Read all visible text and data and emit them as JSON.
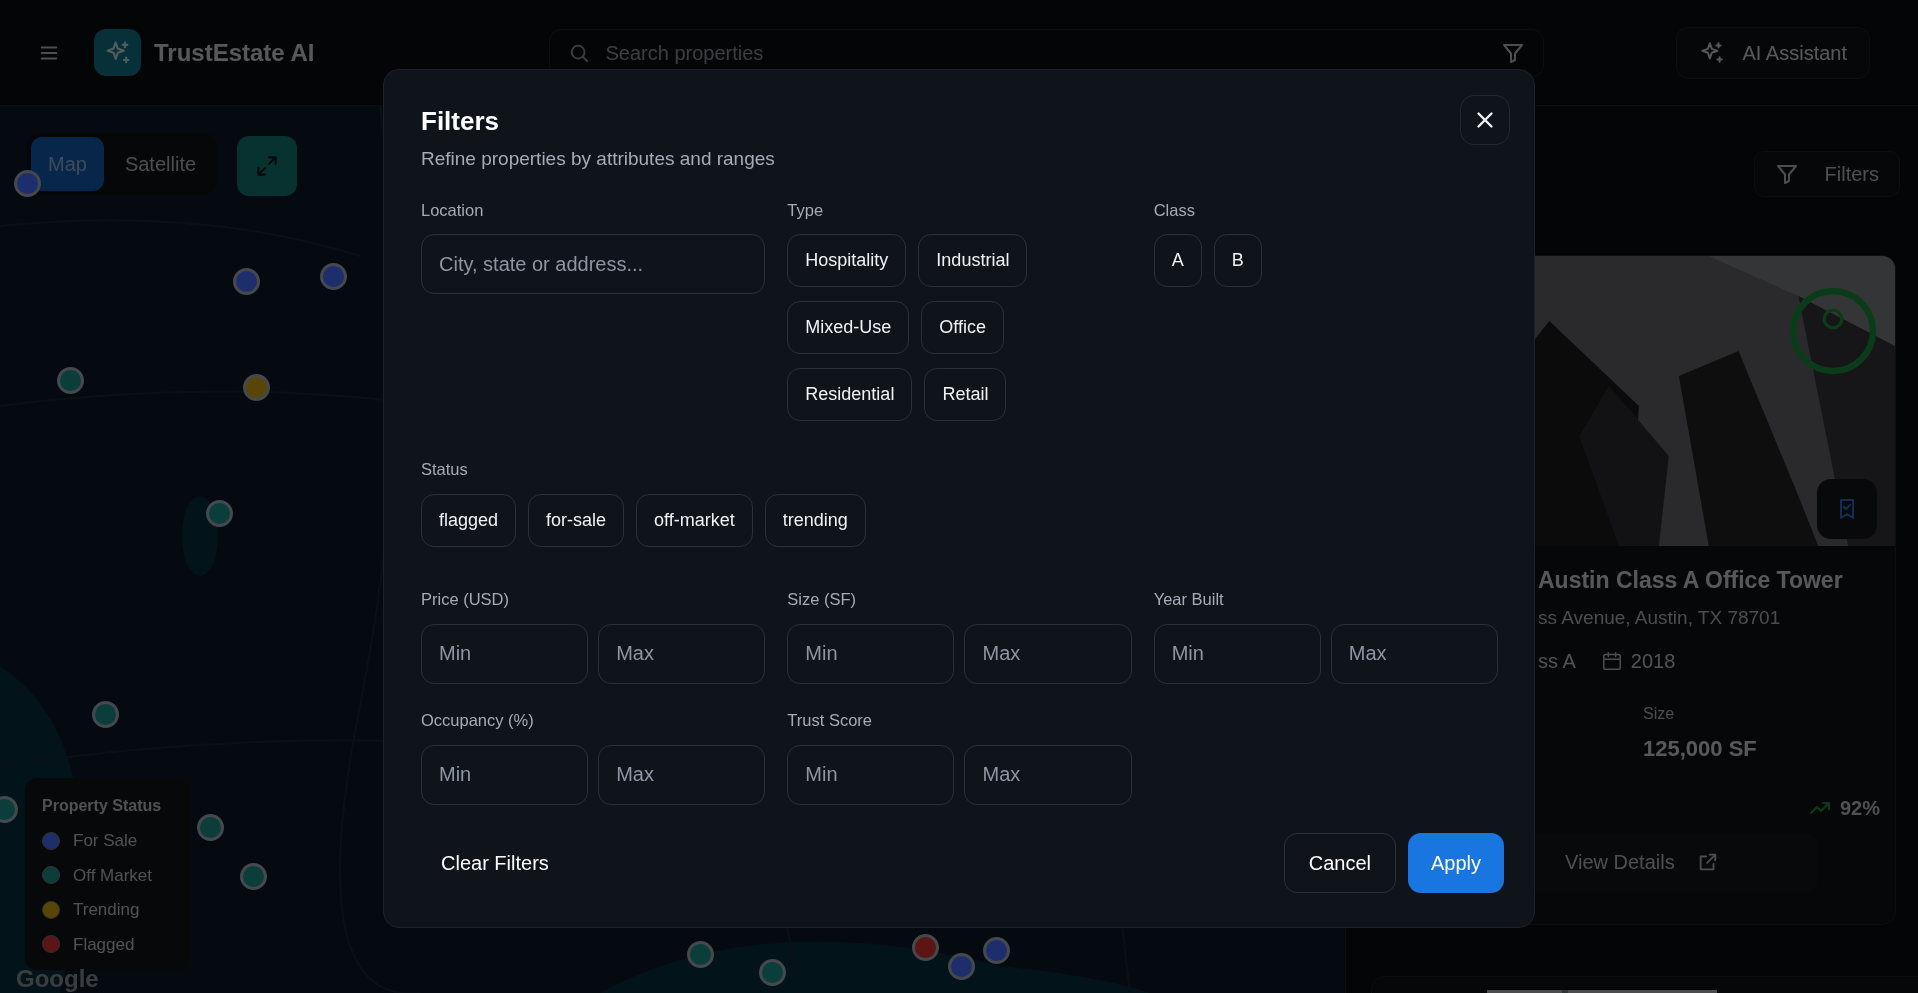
{
  "header": {
    "logo_text": "TrustEstate AI",
    "search": {
      "placeholder": "Search properties"
    },
    "ai_button": "AI Assistant"
  },
  "map": {
    "view_toggle": [
      {
        "label": "Map",
        "selected": true
      },
      {
        "label": "Satellite",
        "selected": false
      }
    ],
    "markers": [
      {
        "color": "#1e2d6b"
      },
      {
        "color": "#1e2d6b"
      },
      {
        "color": "#1e2d6b"
      },
      {
        "color": "#0b3d3b"
      },
      {
        "color": "#5a4508"
      },
      {
        "color": "#0b3d3b"
      },
      {
        "color": "#0b3d3b"
      },
      {
        "color": "#0b3d3b"
      },
      {
        "color": "#0b3d3b"
      },
      {
        "color": "#0b3d3b"
      },
      {
        "color": "#0b3d3b"
      },
      {
        "color": "#0b3d3b"
      },
      {
        "color": "#5c1414"
      },
      {
        "color": "#1e2d6b"
      },
      {
        "color": "#1e2d6b"
      }
    ],
    "legend": {
      "title": "Property Status",
      "items": [
        {
          "label": "For Sale",
          "color": "#1e2d6b"
        },
        {
          "label": "Off Market",
          "color": "#0b3d3b"
        },
        {
          "label": "Trending",
          "color": "#5a4508"
        },
        {
          "label": "Flagged",
          "color": "#5c1414"
        }
      ]
    },
    "attribution": "Google"
  },
  "listing": {
    "filters_button": "Filters",
    "card": {
      "title": "Austin Class A Office Tower",
      "address": "ss Avenue, Austin, TX 78701",
      "class": "ss A",
      "year": "2018",
      "size_label": "Size",
      "size_value": "125,000 SF",
      "trend": "92%",
      "details_button": "View Details"
    }
  },
  "dialog": {
    "title": "Filters",
    "subtitle": "Refine properties by attributes and ranges",
    "location": {
      "label": "Location",
      "placeholder": "City, state or address..."
    },
    "type": {
      "label": "Type",
      "options": [
        {
          "label": "Hospitality",
          "selected": false
        },
        {
          "label": "Industrial",
          "selected": false
        },
        {
          "label": "Mixed-Use",
          "selected": false
        },
        {
          "label": "Office",
          "selected": false
        },
        {
          "label": "Residential",
          "selected": false
        },
        {
          "label": "Retail",
          "selected": false
        }
      ]
    },
    "class": {
      "label": "Class",
      "options": [
        {
          "label": "A",
          "selected": false
        },
        {
          "label": "B",
          "selected": false
        }
      ]
    },
    "status": {
      "label": "Status",
      "options": [
        {
          "label": "flagged",
          "selected": false
        },
        {
          "label": "for-sale",
          "selected": false
        },
        {
          "label": "off-market",
          "selected": false
        },
        {
          "label": "trending",
          "selected": false
        }
      ]
    },
    "ranges": [
      {
        "label": "Price (USD)",
        "min": {
          "placeholder": "Min"
        },
        "max": {
          "placeholder": "Max"
        }
      },
      {
        "label": "Size (SF)",
        "min": {
          "placeholder": "Min"
        },
        "max": {
          "placeholder": "Max"
        }
      },
      {
        "label": "Year Built",
        "min": {
          "placeholder": "Min"
        },
        "max": {
          "placeholder": "Max"
        }
      },
      {
        "label": "Occupancy (%)",
        "min": {
          "placeholder": "Min"
        },
        "max": {
          "placeholder": "Max"
        }
      },
      {
        "label": "Trust Score",
        "min": {
          "placeholder": "Min"
        },
        "max": {
          "placeholder": "Max"
        }
      }
    ],
    "buttons": {
      "clear": "Clear Filters",
      "cancel": "Cancel",
      "apply": "Apply"
    }
  }
}
